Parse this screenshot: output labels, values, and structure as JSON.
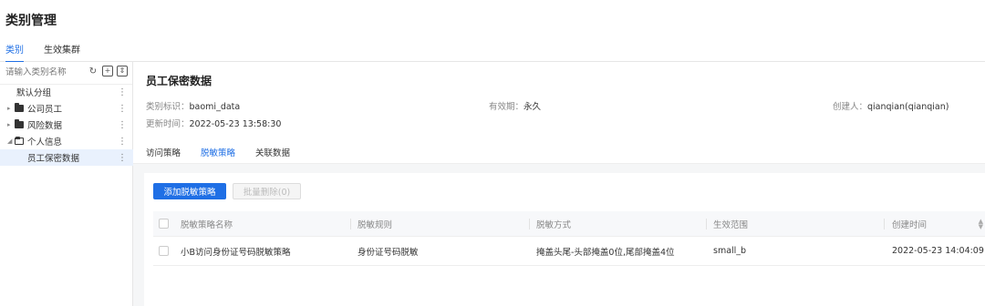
{
  "page": {
    "title": "类别管理"
  },
  "top_tabs": [
    {
      "label": "类别",
      "active": true
    },
    {
      "label": "生效集群",
      "active": false
    }
  ],
  "sidebar": {
    "search_placeholder": "请输入类别名称",
    "tools": {
      "refresh": "refresh-icon",
      "add": "add-icon",
      "collapse": "collapse-icon"
    },
    "tree": [
      {
        "label": "默认分组",
        "level": 0,
        "folder": false,
        "caret": ""
      },
      {
        "label": "公司员工",
        "level": 0,
        "folder": true,
        "caret": "▸"
      },
      {
        "label": "风险数据",
        "level": 0,
        "folder": true,
        "caret": "▸"
      },
      {
        "label": "个人信息",
        "level": 0,
        "folder": true,
        "caret": "◢",
        "open": true
      },
      {
        "label": "员工保密数据",
        "level": 1,
        "folder": false,
        "caret": "",
        "selected": true
      }
    ]
  },
  "detail": {
    "title": "员工保密数据",
    "meta": {
      "id_key": "类别标识：",
      "id_val": "baomi_data",
      "valid_key": "有效期：",
      "valid_val": "永久",
      "creator_key": "创建人：",
      "creator_val": "qianqian(qianqian)",
      "updated_key": "更新时间：",
      "updated_val": "2022-05-23 13:58:30"
    },
    "tabs": [
      {
        "label": "访问策略",
        "active": false
      },
      {
        "label": "脱敏策略",
        "active": true
      },
      {
        "label": "关联数据",
        "active": false
      }
    ]
  },
  "actions": {
    "add_label": "添加脱敏策略",
    "batch_delete_label": "批量删除(0)"
  },
  "table": {
    "headers": [
      "脱敏策略名称",
      "脱敏规则",
      "脱敏方式",
      "生效范围",
      "创建时间"
    ],
    "rows": [
      [
        "小B访问身份证号码脱敏策略",
        "身份证号码脱敏",
        "掩盖头尾-头部掩盖0位,尾部掩盖4位",
        "small_b",
        "2022-05-23 14:04:09"
      ]
    ]
  },
  "colors": {
    "accent": "#1f6fe5",
    "selected_bg": "#e9f1fd",
    "content_bg": "#f5f6f7"
  }
}
